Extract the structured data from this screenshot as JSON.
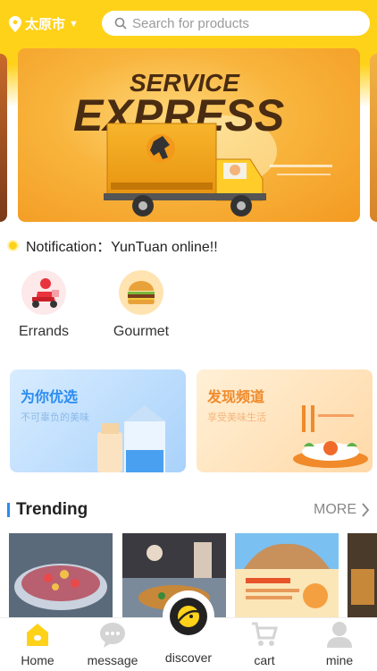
{
  "header": {
    "city": "太原市",
    "search_placeholder": "Search for products"
  },
  "banner": {
    "line1": "SERVICE",
    "line2": "EXPRESS"
  },
  "notification": {
    "text": "Notification：YunTuan online!!"
  },
  "categories": [
    {
      "label": "Errands",
      "icon": "errand-rider-icon"
    },
    {
      "label": "Gourmet",
      "icon": "burger-icon"
    }
  ],
  "promos": [
    {
      "title": "为你优选",
      "subtitle": "不可辜负的美味"
    },
    {
      "title": "发现频道",
      "subtitle": "享受美味生活"
    }
  ],
  "trending": {
    "title": "Trending",
    "more_label": "MORE"
  },
  "tabbar": [
    {
      "label": "Home",
      "icon": "home-icon",
      "active": true
    },
    {
      "label": "message",
      "icon": "message-icon",
      "active": false
    },
    {
      "label": "discover",
      "icon": "discover-icon",
      "active": false
    },
    {
      "label": "cart",
      "icon": "cart-icon",
      "active": false
    },
    {
      "label": "mine",
      "icon": "user-icon",
      "active": false
    }
  ],
  "colors": {
    "brand_yellow": "#ffd21a",
    "accent_blue": "#2a8cf0",
    "accent_orange": "#f08a2a"
  }
}
